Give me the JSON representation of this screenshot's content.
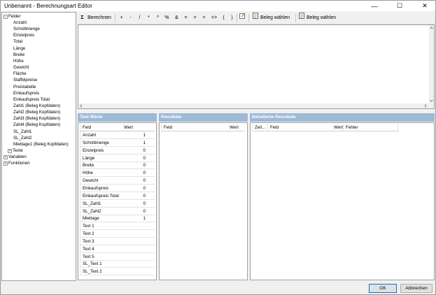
{
  "window": {
    "title": "Unbenannt - Berechnungsart Editor",
    "minimize": "—",
    "maximize": "☐",
    "close": "✕"
  },
  "tree": {
    "root": "Felder",
    "fields": [
      "Anzahl",
      "Schnittmenge",
      "Einzelpreis",
      "Total",
      "Länge",
      "Breite",
      "Höhe",
      "Gewicht",
      "Fläche",
      "Staffelpreise",
      "Preistabelle",
      "Einkaufspreis",
      "Einkaufspreis Total",
      "Zahl1 (Beleg Kopfdaten)",
      "Zahl2 (Beleg Kopfdaten)",
      "Zahl3 (Beleg Kopfdaten)",
      "Zahl4 (Beleg Kopfdaten)",
      "SL_Zahl1",
      "SL_Zahl2",
      "Miettage1 (Beleg Kopfdaten)"
    ],
    "texte": "Texte",
    "variablen": "Variablen",
    "funktionen": "Funktionen",
    "collapsed_glyph": "+",
    "expanded_glyph": "−"
  },
  "toolbar": {
    "sigma": "Σ",
    "calc": "Berechnen",
    "ops": [
      "+",
      "-",
      "/",
      "*",
      "^",
      "%",
      "&",
      "=",
      ">",
      "<",
      "<>",
      "(",
      ")"
    ],
    "beleg1": "Beleg wählen",
    "beleg2": "Beleg wählen"
  },
  "panels": {
    "test": "Test Werte",
    "results": "Resultate",
    "detailed": "Detailierte Resultate"
  },
  "test_grid": {
    "headers": {
      "field": "Feld",
      "value": "Wert"
    },
    "rows": [
      {
        "field": "Anzahl",
        "value": "1"
      },
      {
        "field": "Schnittmenge",
        "value": "1"
      },
      {
        "field": "Einzelpreis",
        "value": "0"
      },
      {
        "field": "Länge",
        "value": "0"
      },
      {
        "field": "Breite",
        "value": "0"
      },
      {
        "field": "Höhe",
        "value": "0"
      },
      {
        "field": "Gewicht",
        "value": "0"
      },
      {
        "field": "Einkaufspreis",
        "value": "0"
      },
      {
        "field": "Einkaufspreis Total",
        "value": "0"
      },
      {
        "field": "SL_Zahl1",
        "value": "0"
      },
      {
        "field": "SL_Zahl2",
        "value": "0"
      },
      {
        "field": "Miettage",
        "value": "1"
      },
      {
        "field": "Text 1",
        "value": ""
      },
      {
        "field": "Text 2",
        "value": ""
      },
      {
        "field": "Text 3",
        "value": ""
      },
      {
        "field": "Text 4",
        "value": ""
      },
      {
        "field": "Text 5",
        "value": ""
      },
      {
        "field": "SL_Text 1",
        "value": ""
      },
      {
        "field": "SL_Text 2",
        "value": ""
      }
    ]
  },
  "results_grid": {
    "headers": {
      "field": "Feld",
      "value": "Wert"
    }
  },
  "detailed_grid": {
    "headers": {
      "line": "Zeil...",
      "field": "Feld",
      "value": "Wert",
      "error": "Fehler"
    }
  },
  "buttons": {
    "ok": "OK",
    "cancel": "Abbrechen"
  }
}
